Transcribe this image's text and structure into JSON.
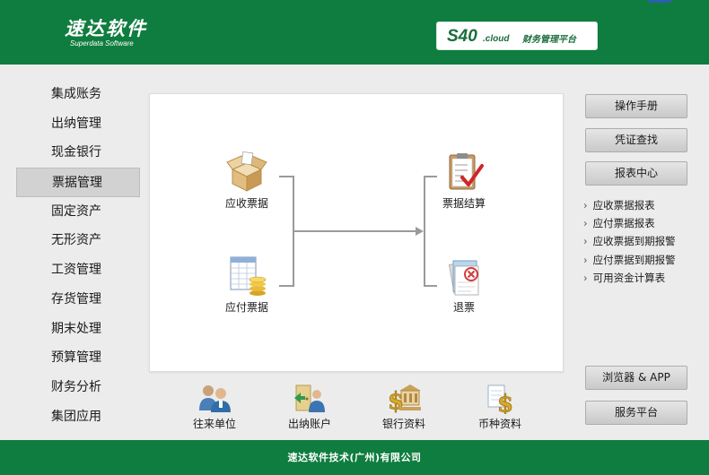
{
  "header": {
    "logo_cn": "速达软件",
    "logo_en": "Superdata Software",
    "platform_code": "S40",
    "platform_suffix": ".cloud",
    "platform_text": "财务管理平台"
  },
  "sidebar": {
    "active_index": 3,
    "items": [
      {
        "label": "集成账务"
      },
      {
        "label": "出纳管理"
      },
      {
        "label": "现金银行"
      },
      {
        "label": "票据管理"
      },
      {
        "label": "固定资产"
      },
      {
        "label": "无形资产"
      },
      {
        "label": "工资管理"
      },
      {
        "label": "存货管理"
      },
      {
        "label": "期末处理"
      },
      {
        "label": "预算管理"
      },
      {
        "label": "财务分析"
      },
      {
        "label": "集团应用"
      }
    ]
  },
  "flow": {
    "receivable": {
      "label": "应收票据",
      "icon": "open-box-icon"
    },
    "payable": {
      "label": "应付票据",
      "icon": "spreadsheet-coins-icon"
    },
    "settle": {
      "label": "票据结算",
      "icon": "checklist-clipboard-icon"
    },
    "refund": {
      "label": "退票",
      "icon": "cancel-document-icon"
    }
  },
  "right_panel": {
    "manual": "操作手册",
    "voucher_search": "凭证查找",
    "report_center": "报表中心",
    "report_links": [
      "应收票据报表",
      "应付票据报表",
      "应收票据到期报警",
      "应付票据到期报警",
      "可用资金计算表"
    ],
    "browser_app": "浏览器 & APP",
    "service_platform": "服务平台"
  },
  "shortcuts": [
    {
      "label": "往来单位",
      "icon": "people-icon"
    },
    {
      "label": "出纳账户",
      "icon": "door-user-icon"
    },
    {
      "label": "银行资料",
      "icon": "bank-dollar-icon"
    },
    {
      "label": "币种资料",
      "icon": "currency-document-icon"
    }
  ],
  "footer": {
    "company": "速达软件技术(广州)有限公司"
  },
  "colors": {
    "brand_green": "#0f7d3f",
    "panel_bg": "#ececec",
    "button_border": "#adadad"
  }
}
